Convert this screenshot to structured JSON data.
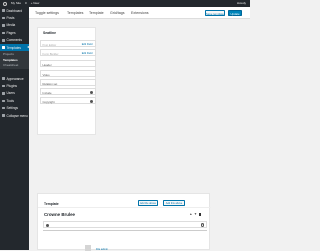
{
  "adminbar": {
    "site_name": "My Site",
    "comments": "0",
    "new": "+ New",
    "account": "Howdy"
  },
  "sidebar": {
    "items": [
      {
        "label": "Dashboard"
      },
      {
        "label": "Posts"
      },
      {
        "label": "Media"
      },
      {
        "label": "Pages"
      },
      {
        "label": "Comments"
      },
      {
        "label": "Templates"
      }
    ],
    "submenu": [
      "Projects",
      "Templates",
      "Cheatsheet"
    ],
    "items_after": [
      {
        "label": "Appearance"
      },
      {
        "label": "Plugins"
      },
      {
        "label": "Users"
      },
      {
        "label": "Tools"
      },
      {
        "label": "Settings"
      },
      {
        "label": "Collapse menu"
      }
    ]
  },
  "topnav": {
    "tabs": [
      "Toggle settings",
      "Templates",
      "Template",
      "Grid/tags",
      "Extensions"
    ],
    "btn_save_draft": "Save template",
    "btn_update": "Update"
  },
  "builder": {
    "title": "Seatline",
    "rows": [
      {
        "label": "Post Editor",
        "link": "Edit Field"
      },
      {
        "label": "Form Builder",
        "link": "Edit Field"
      },
      {
        "label": "Header"
      },
      {
        "label": "Video"
      },
      {
        "label": "Relation set"
      },
      {
        "label": "Include"
      },
      {
        "label": "Copyright"
      }
    ]
  },
  "template": {
    "header_title": "Template",
    "btn_add_template": "Add the above",
    "btn_add_element": "Add this above",
    "name": "Crowne Brulee",
    "link_text": "File admin"
  }
}
